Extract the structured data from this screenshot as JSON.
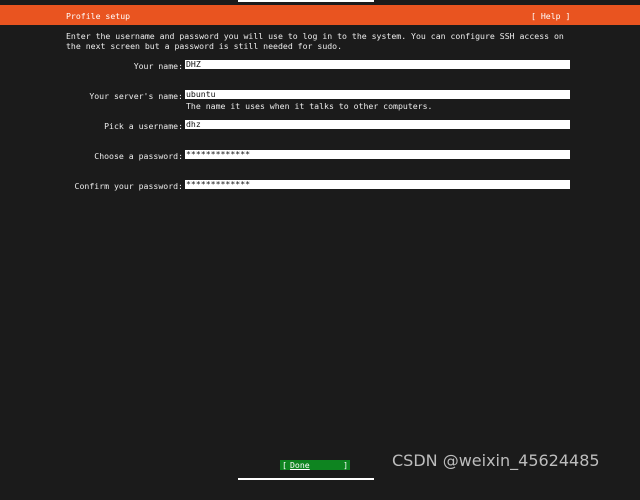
{
  "header": {
    "title": "Profile setup",
    "help_label": "[ Help ]",
    "color": "#e95420"
  },
  "intro": "Enter the username and password you will use to log in to the system. You can configure SSH access on\nthe next screen but a password is still needed for sudo.",
  "form": {
    "your_name": {
      "label": "Your name:",
      "value": "DHZ"
    },
    "server_name": {
      "label": "Your server's name:",
      "value": "ubuntu",
      "help": "The name it uses when it talks to other computers."
    },
    "username": {
      "label": "Pick a username:",
      "value": "dhz"
    },
    "password": {
      "label": "Choose a password:",
      "value": "*************"
    },
    "confirm_password": {
      "label": "Confirm your password:",
      "value": "*************"
    }
  },
  "done_button": {
    "left_bracket": "[",
    "label": "Done",
    "right_bracket": "]",
    "color": "#0e8420"
  },
  "watermark": "CSDN @weixin_45624485"
}
